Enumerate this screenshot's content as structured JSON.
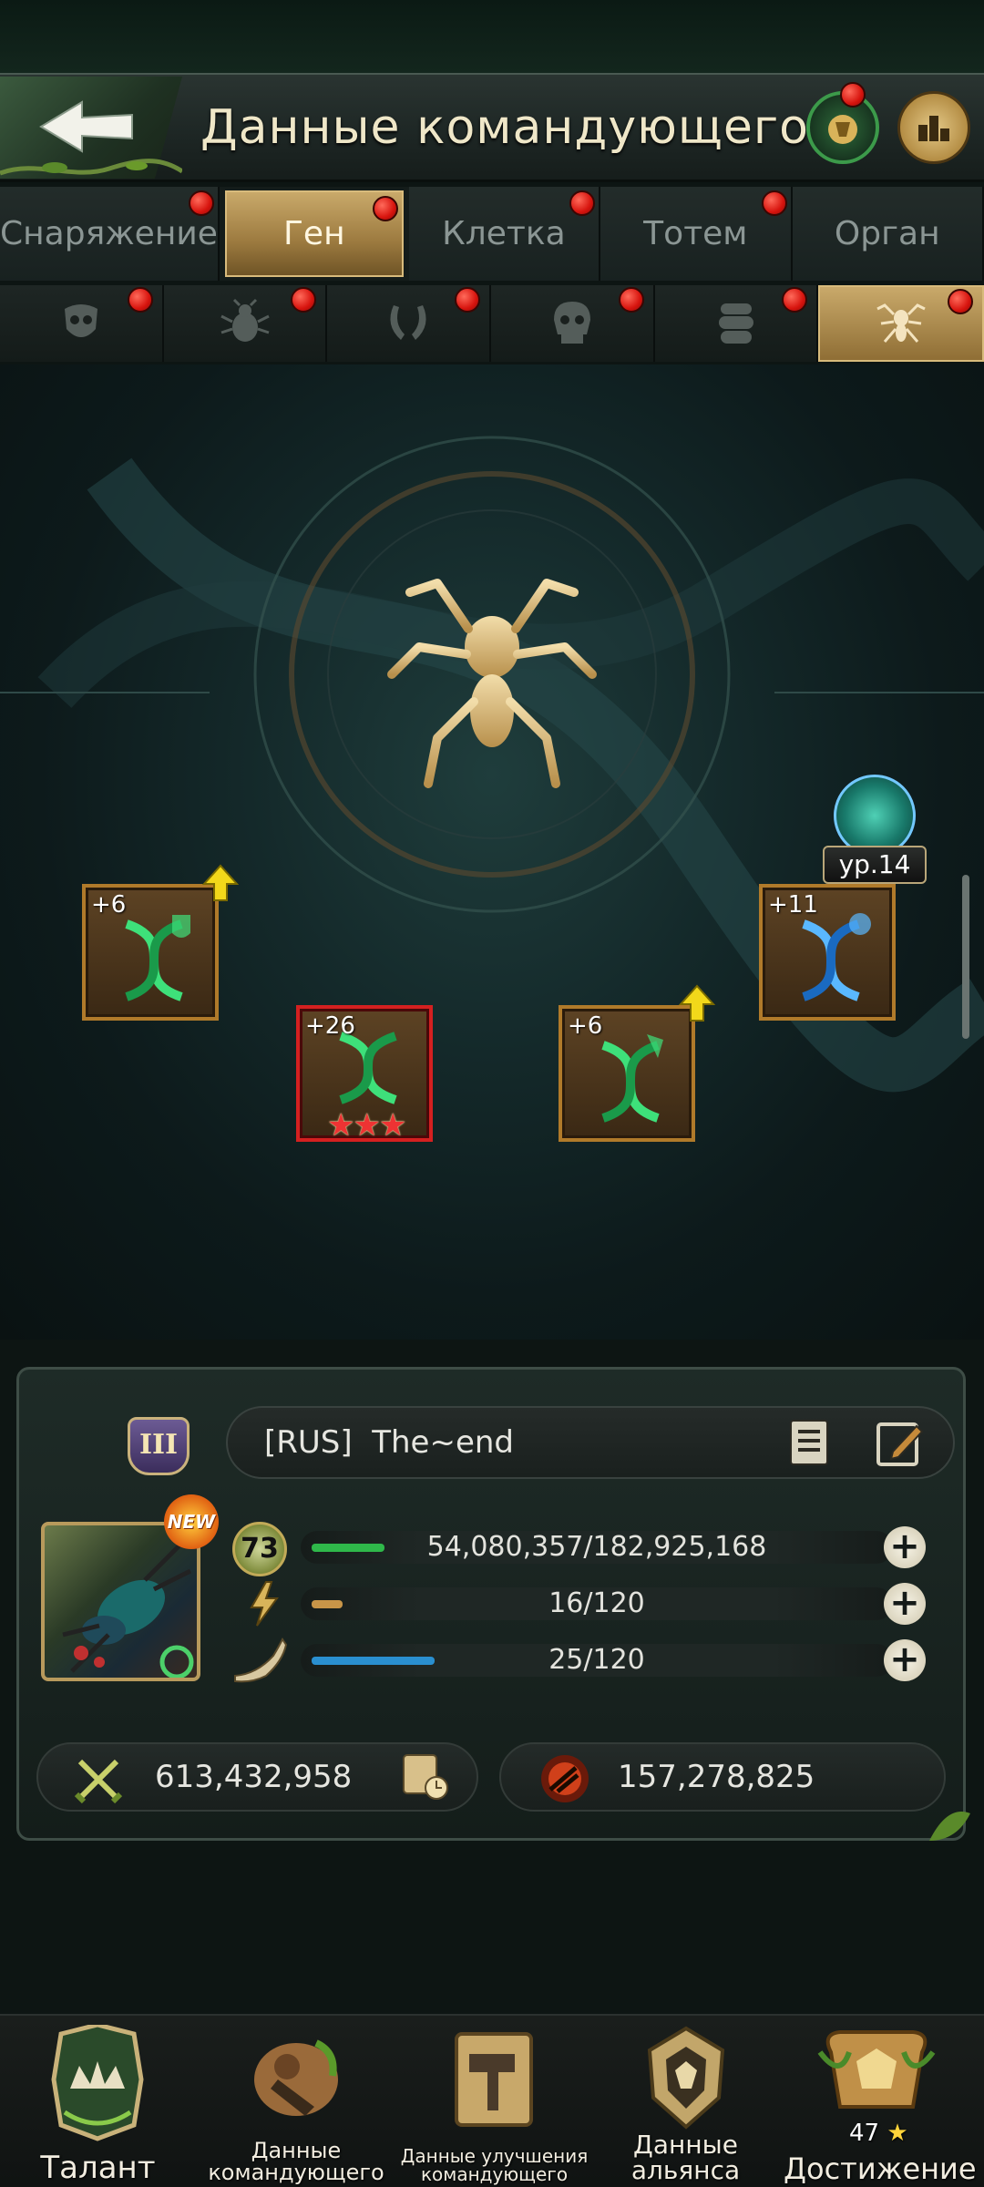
{
  "header": {
    "title": "Данные командующего",
    "back_icon": "back-arrow-icon",
    "news_icon": "news-icon",
    "rank_icon": "ranking-icon"
  },
  "tabs": [
    {
      "label": "Снаряжение",
      "active": false,
      "dot": true
    },
    {
      "label": "Ген",
      "active": true,
      "dot": true
    },
    {
      "label": "Клетка",
      "active": false,
      "dot": true
    },
    {
      "label": "Тотем",
      "active": false,
      "dot": true
    },
    {
      "label": "Орган",
      "active": false,
      "dot": false
    }
  ],
  "subtabs": [
    {
      "icon": "insect-head-icon",
      "active": false
    },
    {
      "icon": "beetle-icon",
      "active": false
    },
    {
      "icon": "mandible-icon",
      "active": false
    },
    {
      "icon": "skull-icon",
      "active": false
    },
    {
      "icon": "larva-icon",
      "active": false
    },
    {
      "icon": "ant-icon",
      "active": true
    }
  ],
  "gene": {
    "level": "ур.14",
    "center_icon": "ant-icon",
    "cards": [
      {
        "bonus": "+6",
        "upgradable": true,
        "color": "green",
        "stars": 0
      },
      {
        "bonus": "+26",
        "upgradable": false,
        "color": "green",
        "stars": 3
      },
      {
        "bonus": "+6",
        "upgradable": true,
        "color": "green",
        "stars": 0
      },
      {
        "bonus": "+11",
        "upgradable": false,
        "color": "blue",
        "stars": 0
      }
    ]
  },
  "commander": {
    "rank": "III",
    "name": "[RUS]  The~end",
    "new_badge": "NEW",
    "level": "73",
    "experience": "54,080,357/182,925,168",
    "experience_fraction": 0.2956,
    "energy": "16/120",
    "energy_fraction": 0.1333,
    "horn": "25/120",
    "horn_fraction": 0.2083,
    "power": "613,432,958",
    "kills": "157,278,825"
  },
  "nav": [
    {
      "label": "Талант",
      "icon": "talent-crown-icon"
    },
    {
      "label": "Данные командующего",
      "icon": "commander-data-icon"
    },
    {
      "label": "Данные улучшения командующего",
      "icon": "upgrade-hammer-icon"
    },
    {
      "label": "Данные альянса",
      "icon": "alliance-shield-icon"
    },
    {
      "label": "Достижение",
      "icon": "achievement-trophy-icon",
      "count": "47"
    }
  ],
  "colors": {
    "accent_gold": "#c9a96a",
    "exp_bar": "#2fb84a",
    "energy_bar": "#c89548",
    "horn_bar": "#2a8fd0",
    "notify_red": "#d7140e"
  }
}
